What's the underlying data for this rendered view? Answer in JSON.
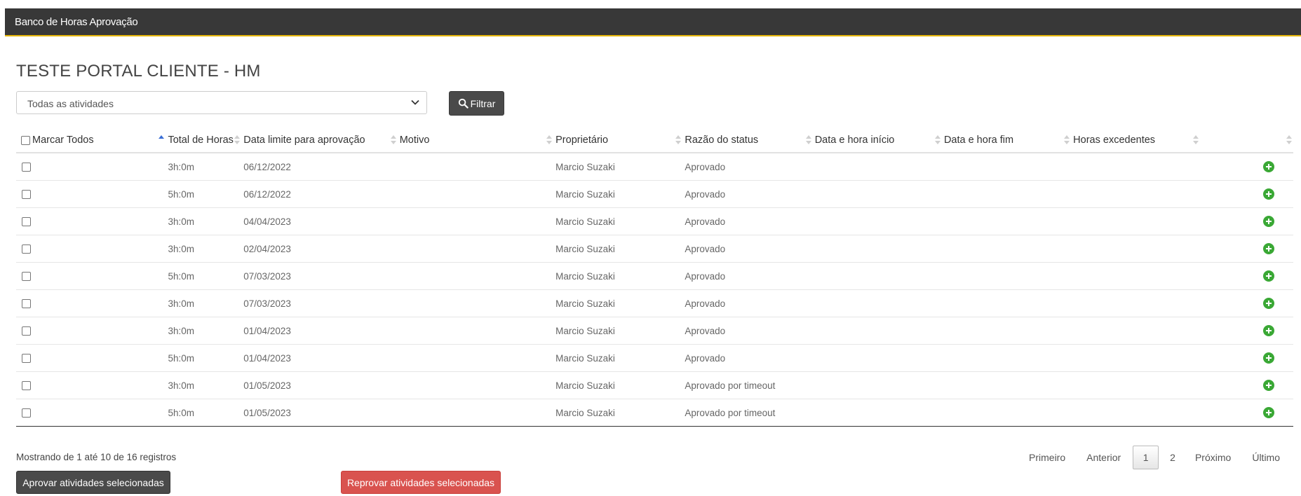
{
  "header": {
    "title": "Banco de Horas Aprovação"
  },
  "page": {
    "title": "TESTE PORTAL CLIENTE - HM"
  },
  "filter": {
    "selected": "Todas as atividades",
    "button_label": "Filtrar"
  },
  "table": {
    "columns": [
      "Marcar Todos",
      "Total de Horas",
      "Data limite para aprovação",
      "Motivo",
      "Proprietário",
      "Razão do status",
      "Data e hora início",
      "Data e hora fim",
      "Horas excedentes",
      ""
    ],
    "sorted_column": "Marcar Todos",
    "rows": [
      {
        "hours": "3h:0m",
        "deadline": "06/12/2022",
        "reason": "",
        "owner": "Marcio Suzaki",
        "status": "Aprovado",
        "start": "",
        "end": "",
        "extra": ""
      },
      {
        "hours": "5h:0m",
        "deadline": "06/12/2022",
        "reason": "",
        "owner": "Marcio Suzaki",
        "status": "Aprovado",
        "start": "",
        "end": "",
        "extra": ""
      },
      {
        "hours": "3h:0m",
        "deadline": "04/04/2023",
        "reason": "",
        "owner": "Marcio Suzaki",
        "status": "Aprovado",
        "start": "",
        "end": "",
        "extra": ""
      },
      {
        "hours": "3h:0m",
        "deadline": "02/04/2023",
        "reason": "",
        "owner": "Marcio Suzaki",
        "status": "Aprovado",
        "start": "",
        "end": "",
        "extra": ""
      },
      {
        "hours": "5h:0m",
        "deadline": "07/03/2023",
        "reason": "",
        "owner": "Marcio Suzaki",
        "status": "Aprovado",
        "start": "",
        "end": "",
        "extra": ""
      },
      {
        "hours": "3h:0m",
        "deadline": "07/03/2023",
        "reason": "",
        "owner": "Marcio Suzaki",
        "status": "Aprovado",
        "start": "",
        "end": "",
        "extra": ""
      },
      {
        "hours": "3h:0m",
        "deadline": "01/04/2023",
        "reason": "",
        "owner": "Marcio Suzaki",
        "status": "Aprovado",
        "start": "",
        "end": "",
        "extra": ""
      },
      {
        "hours": "5h:0m",
        "deadline": "01/04/2023",
        "reason": "",
        "owner": "Marcio Suzaki",
        "status": "Aprovado",
        "start": "",
        "end": "",
        "extra": ""
      },
      {
        "hours": "3h:0m",
        "deadline": "01/05/2023",
        "reason": "",
        "owner": "Marcio Suzaki",
        "status": "Aprovado por timeout",
        "start": "",
        "end": "",
        "extra": ""
      },
      {
        "hours": "5h:0m",
        "deadline": "01/05/2023",
        "reason": "",
        "owner": "Marcio Suzaki",
        "status": "Aprovado por timeout",
        "start": "",
        "end": "",
        "extra": ""
      }
    ]
  },
  "footer": {
    "info": "Mostrando de 1 até 10 de 16 registros",
    "pagination": {
      "first": "Primeiro",
      "previous": "Anterior",
      "pages": [
        "1",
        "2"
      ],
      "current_page": "1",
      "next": "Próximo",
      "last": "Último"
    },
    "approve_label": "Aprovar atividades selecionadas",
    "reject_label": "Reprovar atividades selecionadas"
  },
  "colors": {
    "topbar": "#383838",
    "topbar_accent": "#e5b400",
    "add_icon": "#3aa835",
    "reject_button": "#d9534f",
    "dark_button": "#4a4a4a",
    "sort_active": "#3b6fd6"
  },
  "icons": {
    "filter_button": "search-icon",
    "row_action": "plus-circle-icon",
    "select": "chevron-down-icon"
  }
}
